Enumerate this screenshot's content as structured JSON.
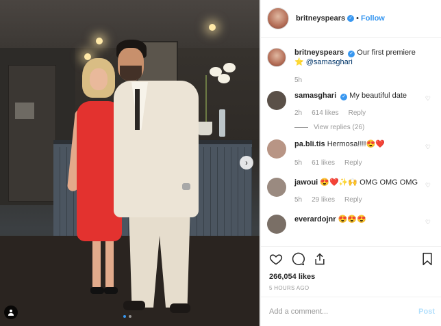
{
  "post": {
    "dots_count": 2,
    "active_slide": 1
  },
  "header": {
    "username": "britneyspears",
    "verified_mark": "✓",
    "separator": "•",
    "follow_label": "Follow"
  },
  "caption": {
    "username": "britneyspears",
    "text": "Our first premiere",
    "emoji": "⭐",
    "mention": "@samasghari",
    "time": "5h"
  },
  "comments": [
    {
      "username": "samasghari",
      "verified": true,
      "text": "My beautiful date",
      "time": "2h",
      "likes": "614 likes",
      "reply": "Reply",
      "view_replies": "View replies (26)",
      "avatar_color": "#5a5048"
    },
    {
      "username": "pa.bli.tis",
      "text": "Hermosa!!!!😍❤️",
      "time": "5h",
      "likes": "61 likes",
      "reply": "Reply",
      "avatar_color": "#b89585"
    },
    {
      "username": "jawoui",
      "text": "😍❤️✨🙌 OMG OMG OMG",
      "time": "5h",
      "likes": "29 likes",
      "reply": "Reply",
      "avatar_color": "#9a8a80"
    },
    {
      "username": "everardojnr",
      "text": "😍😍😍",
      "avatar_color": "#7a6f66"
    }
  ],
  "actions": {
    "likes": "266,054 likes",
    "ago": "5 HOURS AGO"
  },
  "add_comment": {
    "placeholder": "Add a comment...",
    "post_label": "Post"
  },
  "icons": {
    "like": "heart-icon",
    "comment": "comment-icon",
    "share": "share-icon",
    "save": "bookmark-icon",
    "next": "chevron-right-icon",
    "tag": "user-tag-icon",
    "comment_like": "heart-small-icon"
  },
  "colors": {
    "link": "#3897f0",
    "muted": "#999999",
    "border": "#efefef",
    "post_disabled": "#b2dffc"
  }
}
